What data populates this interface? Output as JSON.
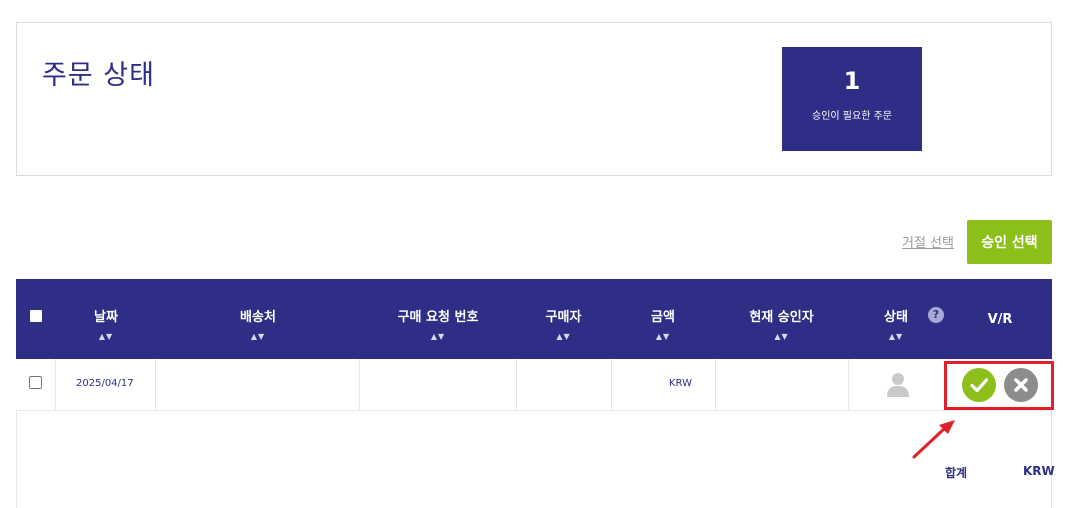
{
  "status_panel": {
    "title": "주문 상태",
    "pending_count": "1",
    "pending_label": "승인이 필요한 주문"
  },
  "toolbar": {
    "reject_selected_label": "거절 선택",
    "approve_selected_label": "승인 선택"
  },
  "table": {
    "columns": [
      {
        "label": "날짜",
        "sortable": true
      },
      {
        "label": "배송처",
        "sortable": true
      },
      {
        "label": "구매 요청 번호",
        "sortable": true
      },
      {
        "label": "구매자",
        "sortable": true
      },
      {
        "label": "금액",
        "sortable": true
      },
      {
        "label": "현재 승인자",
        "sortable": true
      },
      {
        "label": "상태",
        "sortable": true
      },
      {
        "label": "V/R",
        "sortable": false
      }
    ],
    "sort_glyph": "▲▼",
    "help_glyph": "?",
    "rows": [
      {
        "date": "2025/04/17",
        "ship_to": "",
        "request_number": "",
        "buyer": "",
        "amount_currency": "KRW",
        "current_approver": "",
        "status_icon": "person-icon",
        "actions": [
          "approve-icon",
          "reject-icon"
        ]
      }
    ]
  },
  "footer": {
    "total_label": "합계",
    "total_currency": "KRW"
  },
  "colors": {
    "brand_navy": "#2e2e86",
    "approve_green": "#8cbf1a",
    "reject_gray": "#8c8c8c",
    "highlight_red": "#e0202a"
  }
}
